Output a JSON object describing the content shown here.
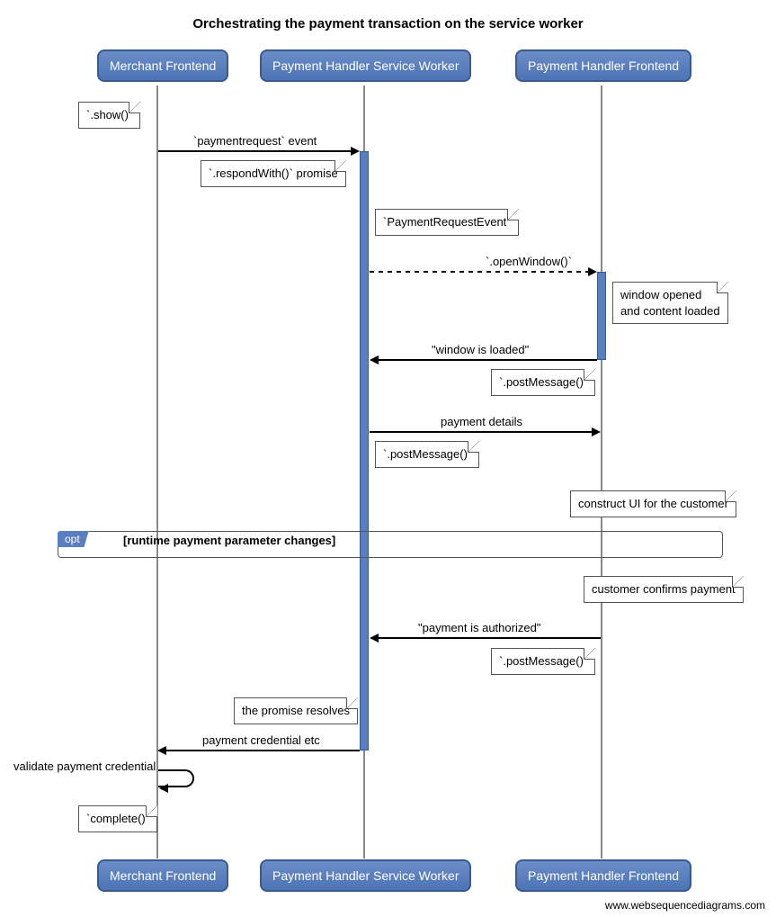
{
  "title": "Orchestrating the payment transaction on the service worker",
  "participants": {
    "p1": "Merchant Frontend",
    "p2": "Payment Handler Service Worker",
    "p3": "Payment Handler Frontend"
  },
  "notes": {
    "show": "`.show()`",
    "respondWith": "`.respondWith()` promise",
    "paymentRequestEvent": "`PaymentRequestEvent`",
    "windowOpened": "window opened\nand content loaded",
    "postMessage1": "`.postMessage()`",
    "postMessage2": "`.postMessage()`",
    "constructUI": "construct UI for the customer",
    "customerConfirms": "customer confirms payment",
    "postMessage3": "`.postMessage()`",
    "promiseResolves": "the promise resolves",
    "complete": "`complete()`"
  },
  "messages": {
    "paymentrequest": "`paymentrequest` event",
    "openWindow": "`.openWindow()`",
    "windowLoaded": "\"window is loaded\"",
    "paymentDetails": "payment details",
    "paymentAuthorized": "\"payment is authorized\"",
    "paymentCredential": "payment credential etc",
    "validatePayment": "validate payment credential"
  },
  "opt": {
    "tag": "opt",
    "condition": "[runtime payment parameter changes]"
  },
  "attribution": "www.websequencediagrams.com"
}
